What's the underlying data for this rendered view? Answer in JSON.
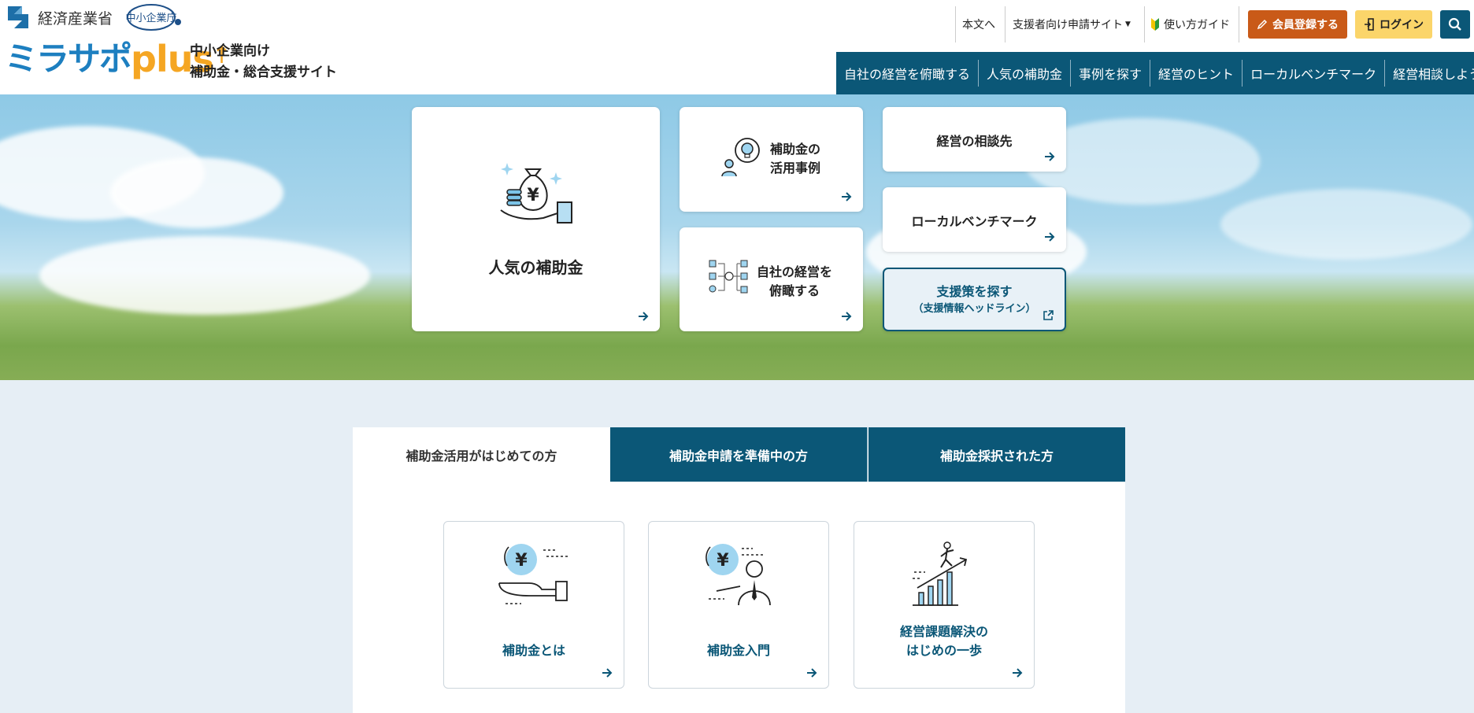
{
  "header": {
    "ministry": "経済産業省",
    "agency_badge": "中小企業庁",
    "logo_main": "ミラサポ",
    "logo_plus": "plus",
    "tagline_line1": "中小企業向け",
    "tagline_line2": "補助金・総合支援サイト",
    "util": {
      "skip_main": "本文へ",
      "for_supporters": "支援者向け申請サイト",
      "guide": "使い方ガイド",
      "register": "会員登録する",
      "login": "ログイン"
    },
    "nav": [
      "自社の経営を俯瞰する",
      "人気の補助金",
      "事例を探す",
      "経営のヒント",
      "ローカルベンチマーク",
      "経営相談しよう"
    ]
  },
  "hero_cards": {
    "popular_subsidy": "人気の補助金",
    "case_line1": "補助金の",
    "case_line2": "活用事例",
    "overview_line1": "自社の経営を",
    "overview_line2": "俯瞰する",
    "consult": "経営の相談先",
    "local_benchmark": "ローカルベンチマーク",
    "find_support_line1": "支援策を探す",
    "find_support_line2": "（支援情報ヘッドライン）"
  },
  "tabs": [
    "補助金活用がはじめての方",
    "補助金申請を準備中の方",
    "補助金採択された方"
  ],
  "tab_cards": {
    "what_is": "補助金とは",
    "intro": "補助金入門",
    "first_step_line1": "経営課題解決の",
    "first_step_line2": "はじめの一歩"
  },
  "colors": {
    "brand_navy": "#0b5777",
    "register_orange": "#c95a18",
    "login_yellow": "#fbd56a",
    "logo_blue": "#1d7fc0",
    "logo_orange": "#f5a623",
    "page_bg": "#e6eef5"
  }
}
